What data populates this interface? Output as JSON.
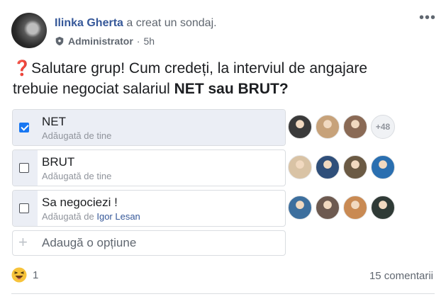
{
  "post": {
    "author": "Ilinka Gherta",
    "action": " a creat un sondaj.",
    "role": "Administrator",
    "separator": "·",
    "time": "5h",
    "question_prefix": "Salutare grup! Cum credeți, la interviul de angajare trebuie negociat salariul ",
    "question_bold": "NET sau BRUT?",
    "question_icon": "red-question-mark"
  },
  "poll": {
    "options": [
      {
        "label": "NET",
        "added_text": "Adăugată de tine",
        "added_by": "",
        "checked": true,
        "fill_percent": 100,
        "voters_colors": [
          "#3a3a3a",
          "#c7a27a",
          "#8a6a55"
        ],
        "more_votes": "+48"
      },
      {
        "label": "BRUT",
        "added_text": "Adăugată de tine",
        "added_by": "",
        "checked": false,
        "fill_percent": 9,
        "voters_colors": [
          "#d9c3a5",
          "#2f4f7a",
          "#6b5a44",
          "#2a6fb0"
        ]
      },
      {
        "label": "Sa negociezi !",
        "added_text": "Adăugată de ",
        "added_by": "Igor Lesan",
        "checked": false,
        "fill_percent": 9,
        "voters_colors": [
          "#3d6f9e",
          "#6d5a50",
          "#c98a53",
          "#2f3a36"
        ]
      }
    ],
    "add_option_placeholder": "Adaugă o opțiune"
  },
  "footer": {
    "reaction_icon": "haha-emoji",
    "reaction_count": "1",
    "comments": "15 comentarii"
  },
  "colors": {
    "link": "#365899",
    "checked": "#1877f2",
    "fill": "#ebeef5"
  }
}
